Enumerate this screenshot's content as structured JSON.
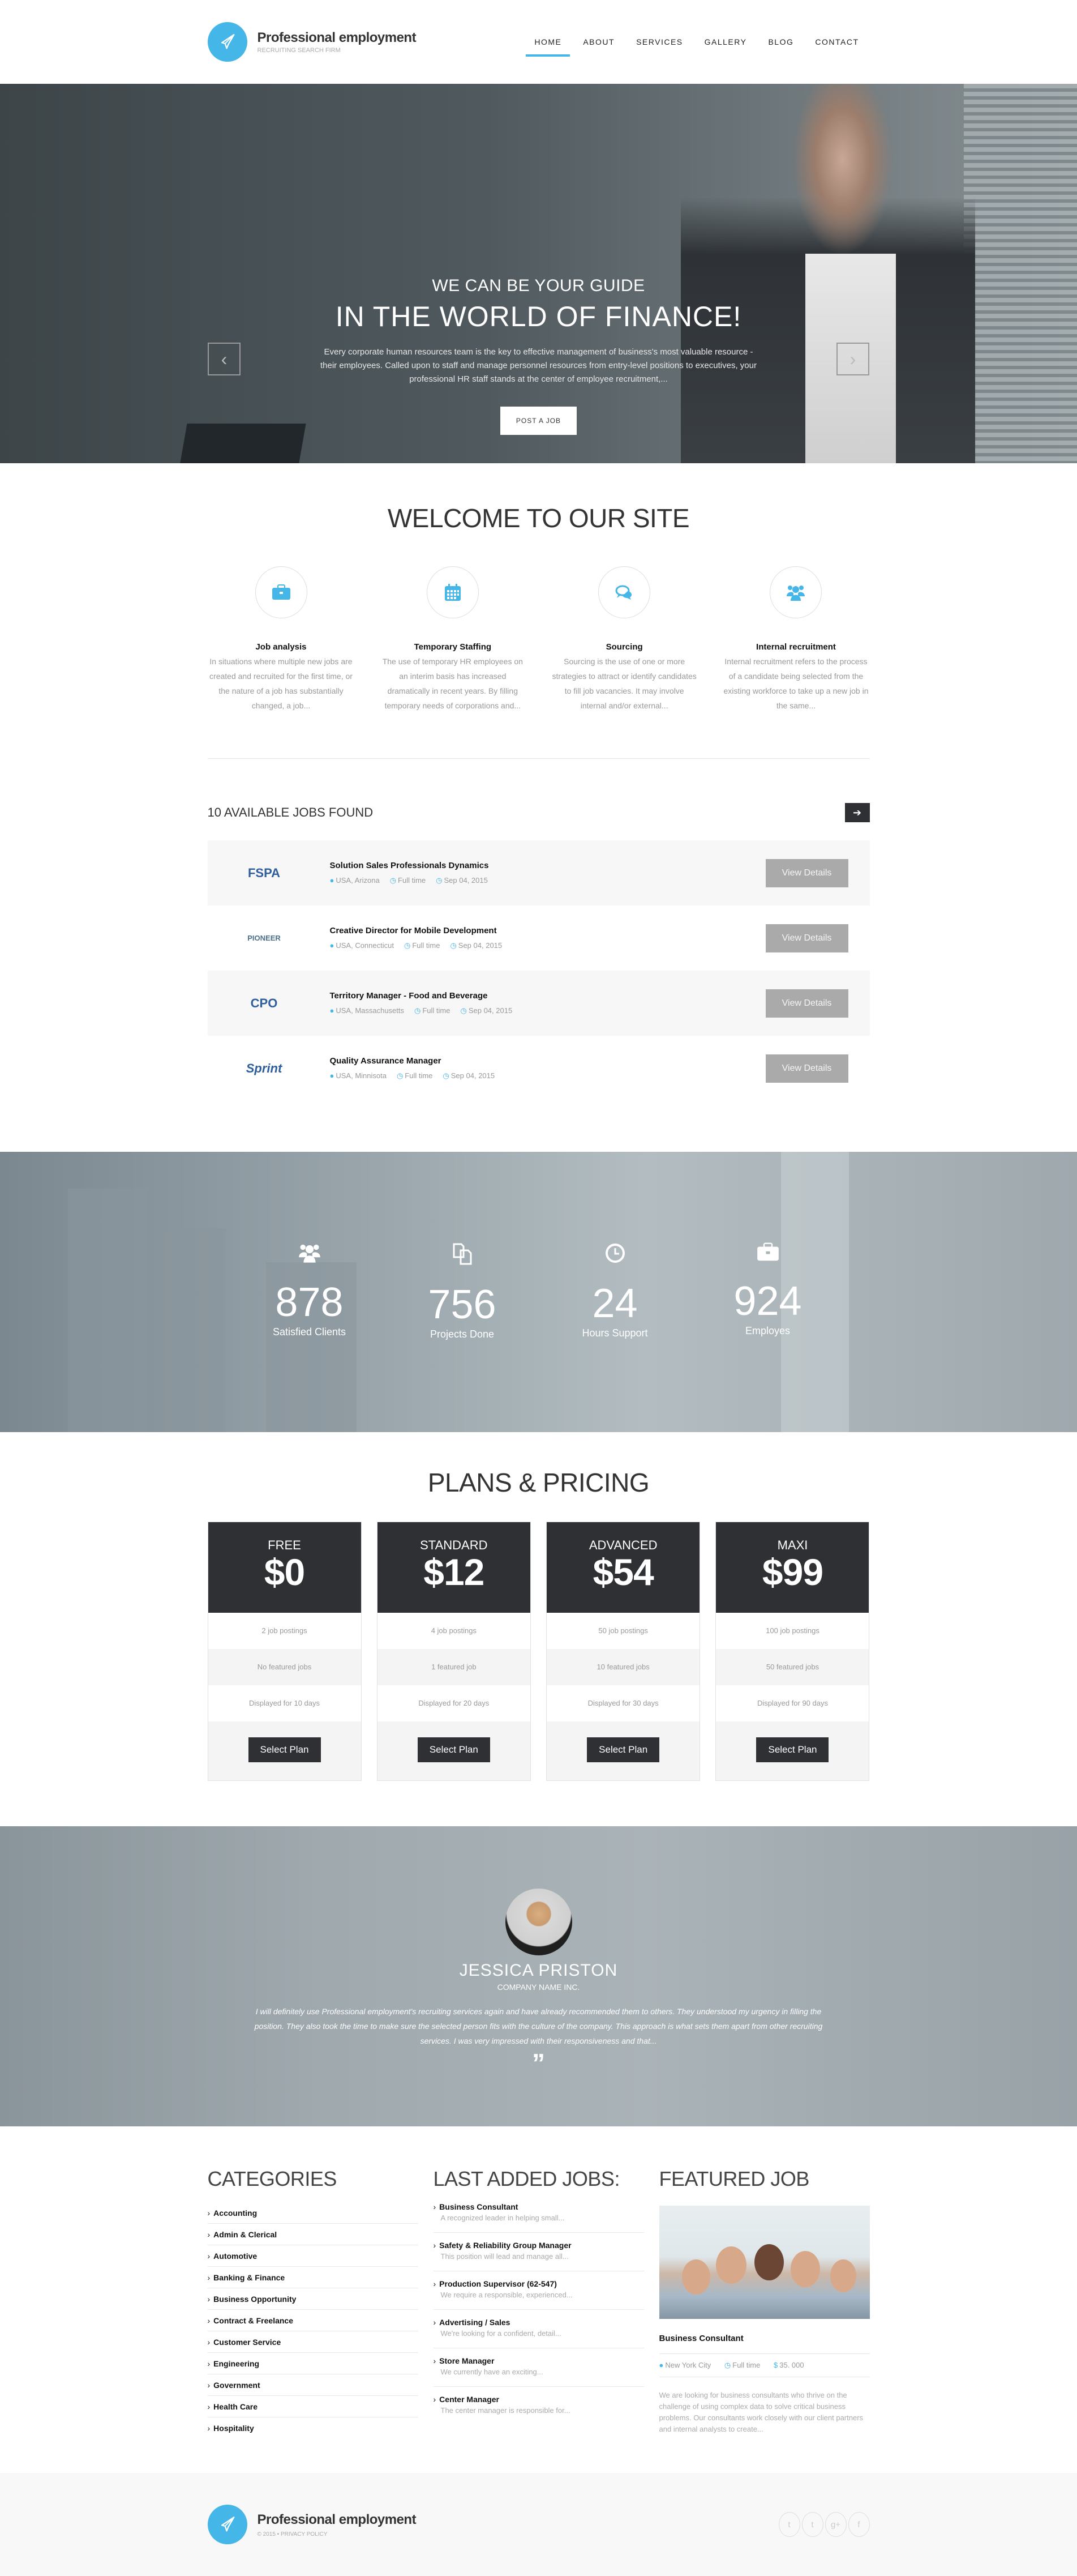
{
  "header": {
    "brand": "Professional employment",
    "tagline": "RECRUITING SEARCH FIRM",
    "nav": [
      {
        "label": "HOME",
        "active": true
      },
      {
        "label": "ABOUT"
      },
      {
        "label": "SERVICES"
      },
      {
        "label": "GALLERY"
      },
      {
        "label": "BLOG"
      },
      {
        "label": "CONTACT"
      }
    ]
  },
  "hero": {
    "pre_title": "WE CAN BE YOUR GUIDE",
    "title": "IN THE WORLD OF FINANCE!",
    "text": "Every corporate human resources team is the key to effective management of business's most valuable resource - their employees. Called upon to staff and manage personnel resources from entry-level positions to executives, your professional HR staff stands at the center of employee recruitment,...",
    "button": "POST A JOB",
    "prev_icon": "‹",
    "next_icon": "›",
    "slides": 3,
    "active_slide": 1
  },
  "welcome": {
    "title": "WELCOME TO OUR SITE",
    "features": [
      {
        "icon": "briefcase-icon",
        "glyph": "💼",
        "title": "Job analysis",
        "text": "In situations where multiple new jobs are created and recruited for the first time, or the nature of a job has substantially changed, a job..."
      },
      {
        "icon": "calendar-icon",
        "glyph": "📅",
        "title": "Temporary Staffing",
        "text": "The use of temporary HR employees on an interim basis has increased dramatically in recent years. By filling temporary needs of corporations and..."
      },
      {
        "icon": "comments-icon",
        "glyph": "💬",
        "title": "Sourcing",
        "text": "Sourcing is the use of one or more strategies to attract or identify candidates to fill job vacancies. It may involve internal and/or external..."
      },
      {
        "icon": "users-icon",
        "glyph": "👥",
        "title": "Internal recruitment",
        "text": "Internal recruitment refers to the process of a candidate being selected from the existing workforce to take up a new job in the same..."
      }
    ]
  },
  "jobs": {
    "heading": "10 AVAILABLE JOBS FOUND",
    "next_icon": "➔",
    "view_label": "View Details",
    "items": [
      {
        "logo": "FSPA",
        "title": "Solution Sales Professionals Dynamics",
        "location": "USA, Arizona",
        "type": "Full time",
        "date": "Sep 04, 2015"
      },
      {
        "logo": "PIONEER",
        "title": "Creative Director for Mobile Development",
        "location": "USA, Connecticut",
        "type": "Full time",
        "date": "Sep 04, 2015"
      },
      {
        "logo": "CPO",
        "title": "Territory Manager - Food and Beverage",
        "location": "USA, Massachusetts",
        "type": "Full time",
        "date": "Sep 04, 2015"
      },
      {
        "logo": "Sprint",
        "title": "Quality Assurance Manager",
        "location": "USA, Minnisota",
        "type": "Full time",
        "date": "Sep 04, 2015"
      }
    ]
  },
  "stats": [
    {
      "icon": "users-icon",
      "glyph": "👥",
      "value": "878",
      "label": "Satisfied Clients"
    },
    {
      "icon": "files-icon",
      "glyph": "⧉",
      "value": "756",
      "label": "Projects Done"
    },
    {
      "icon": "clock-icon",
      "glyph": "◷",
      "value": "24",
      "label": "Hours Support"
    },
    {
      "icon": "briefcase-icon",
      "glyph": "💼",
      "value": "924",
      "label": "Employes"
    }
  ],
  "pricing": {
    "title": "PLANS & PRICING",
    "button": "Select Plan",
    "plans": [
      {
        "name": "FREE",
        "price": "$0",
        "features": [
          "2 job postings",
          "No featured jobs",
          "Displayed for 10 days"
        ]
      },
      {
        "name": "STANDARD",
        "price": "$12",
        "features": [
          "4 job postings",
          "1 featured job",
          "Displayed for 20 days"
        ]
      },
      {
        "name": "ADVANCED",
        "price": "$54",
        "features": [
          "50 job postings",
          "10 featured jobs",
          "Displayed for 30 days"
        ]
      },
      {
        "name": "MAXI",
        "price": "$99",
        "features": [
          "100 job postings",
          "50 featured jobs",
          "Displayed for 90 days"
        ]
      }
    ]
  },
  "testimonial": {
    "name": "JESSICA PRISTON",
    "company": "COMPANY NAME INC.",
    "quote": "I will definitely use Professional employment's recruiting services again and have already recommended them to others. They understood my urgency in filling the position. They also took the time to make sure the selected person fits with the culture of the company. This approach is what sets them apart from other recruiting services. I was very impressed with their responsiveness and that...",
    "quote_mark": "”"
  },
  "categories": {
    "title": "CATEGORIES",
    "items": [
      "Accounting",
      "Admin & Clerical",
      "Automotive",
      "Banking & Finance",
      "Business Opportunity",
      "Contract & Freelance",
      "Customer Service",
      "Engineering",
      "Government",
      "Health Care",
      "Hospitality"
    ]
  },
  "last_jobs": {
    "title": "LAST ADDED JOBS:",
    "items": [
      {
        "title": "Business Consultant",
        "desc": "A recognized leader in helping small..."
      },
      {
        "title": "Safety & Reliability Group Manager",
        "desc": "This position will lead and manage all..."
      },
      {
        "title": "Production Supervisor (62-547)",
        "desc": "We require a responsible, experienced..."
      },
      {
        "title": "Advertising / Sales",
        "desc": "We're looking for a confident, detail..."
      },
      {
        "title": "Store Manager",
        "desc": "We currently have an exciting..."
      },
      {
        "title": "Center Manager",
        "desc": "The center manager is responsible for..."
      }
    ]
  },
  "featured": {
    "title": "FEATURED JOB",
    "job_title": "Business Consultant",
    "location": "New York City",
    "type": "Full time",
    "salary": "35. 000",
    "desc": "We are looking for business consultants who thrive on the challenge of using complex data to solve critical business problems. Our consultants work closely with our client partners and internal analysts to create..."
  },
  "footer": {
    "brand": "Professional employment",
    "copyright": "© 2015 • PRIVACY POLICY",
    "socials": [
      {
        "name": "twitter",
        "glyph": "t"
      },
      {
        "name": "tumblr",
        "glyph": "t"
      },
      {
        "name": "google-plus",
        "glyph": "g+"
      },
      {
        "name": "facebook",
        "glyph": "f"
      }
    ]
  },
  "colors": {
    "accent": "#45b6e8",
    "dark": "#2f3033",
    "muted": "#999999"
  }
}
